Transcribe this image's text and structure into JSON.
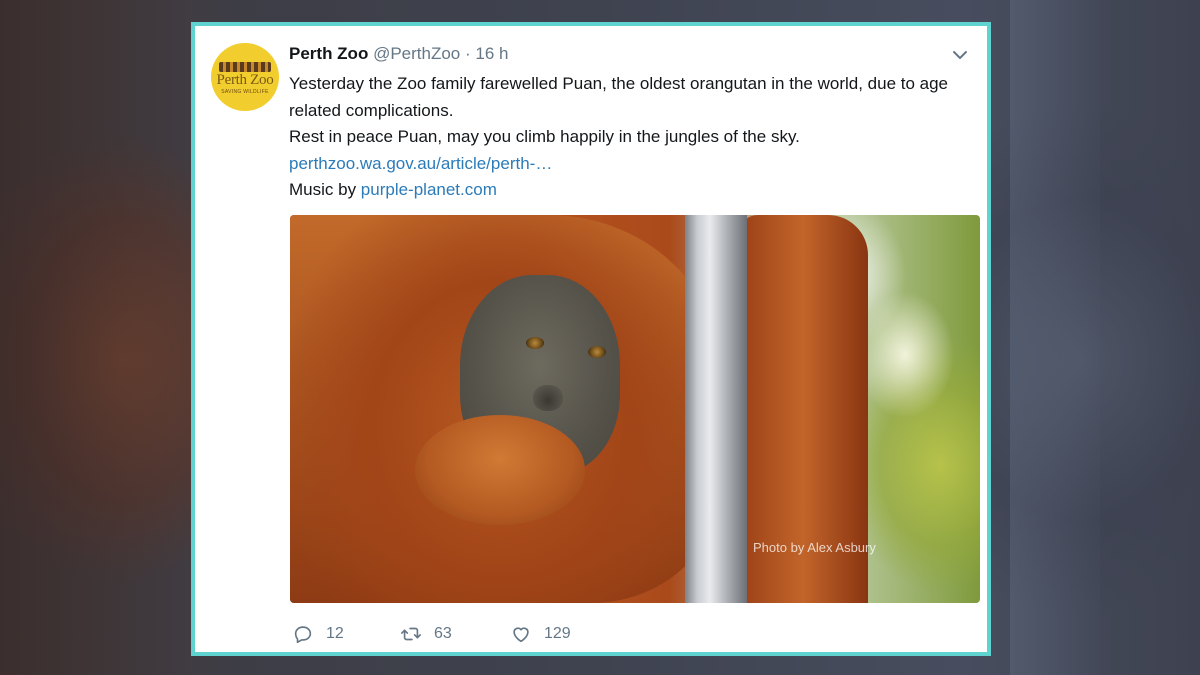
{
  "tweet": {
    "display_name": "Perth Zoo",
    "handle": "@PerthZoo",
    "separator": "·",
    "timestamp": "16 h",
    "avatar": {
      "logo_text": "Perth Zoo",
      "logo_subtext": "SAVING WILDLIFE"
    },
    "text_line_1": "Yesterday the Zoo family farewelled Puan, the oldest orangutan in the world, due to age related complications.",
    "text_line_2": "Rest in peace Puan, may you climb happily in the jungles of the sky.",
    "link_text": "perthzoo.wa.gov.au/article/perth-…",
    "music_prefix": "Music by ",
    "music_link": "purple-planet.com",
    "media": {
      "credit": "Photo by Alex Asbury"
    },
    "actions": {
      "reply_count": "12",
      "retweet_count": "63",
      "like_count": "129"
    }
  },
  "colors": {
    "card_border": "#5fd3cf",
    "link": "#2b7bb9",
    "secondary_text": "#657786"
  },
  "icons": [
    "chevron-down-icon",
    "reply-icon",
    "retweet-icon",
    "like-icon"
  ]
}
